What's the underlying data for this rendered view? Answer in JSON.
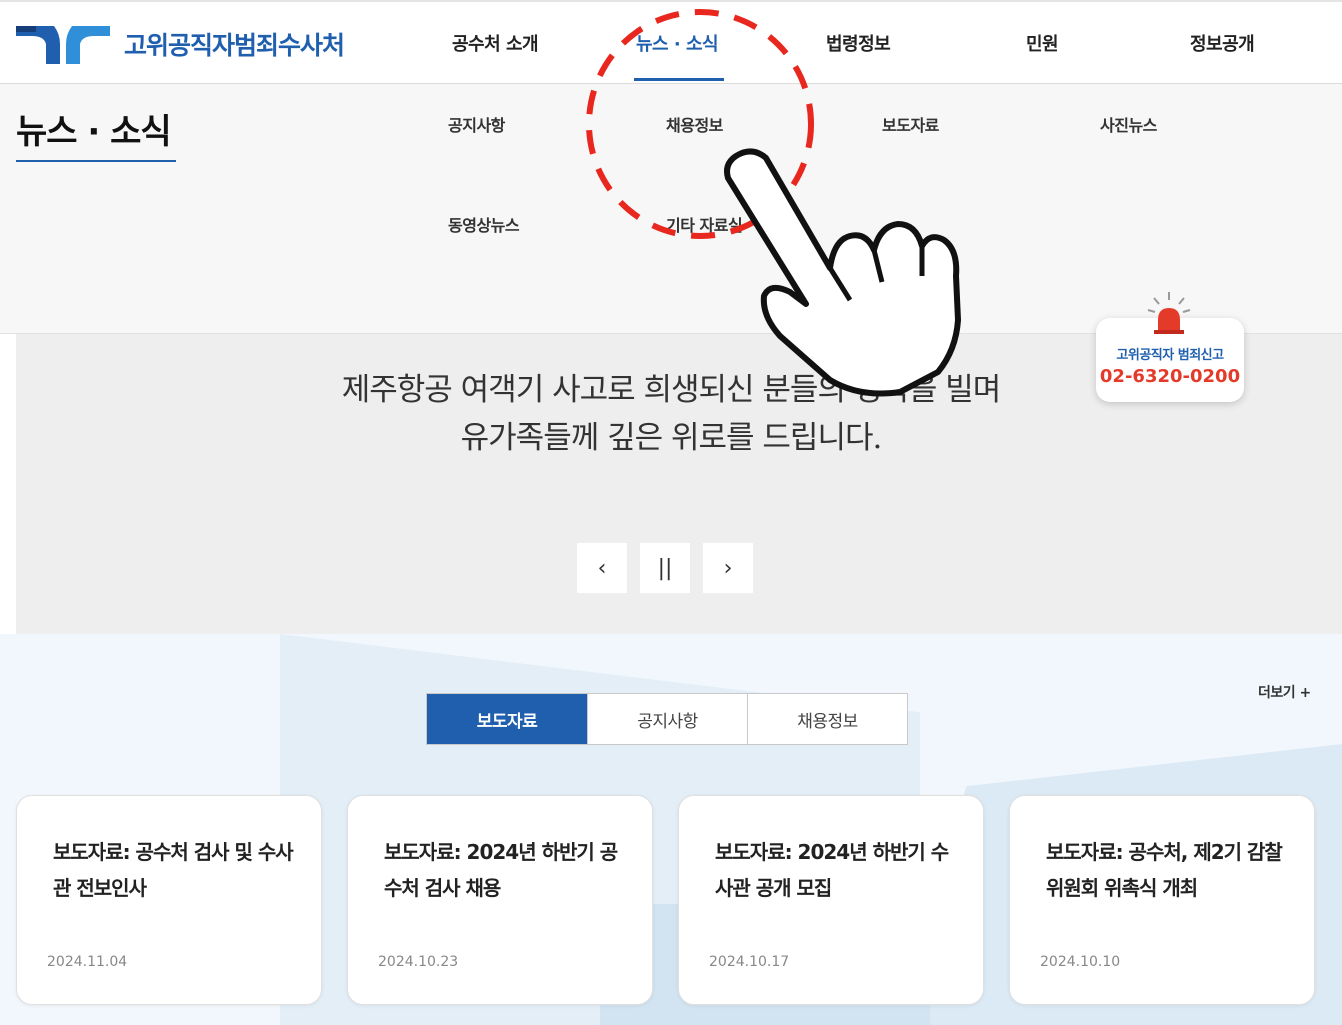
{
  "header": {
    "logo_text": "고위공직자범죄수사처",
    "nav": [
      {
        "label": "공수처 소개"
      },
      {
        "label": "뉴스 · 소식"
      },
      {
        "label": "법령정보"
      },
      {
        "label": "민원"
      },
      {
        "label": "정보공개"
      }
    ]
  },
  "submenu": {
    "title": "뉴스 · 소식",
    "items": [
      {
        "label": "공지사항"
      },
      {
        "label": "채용정보"
      },
      {
        "label": "보도자료"
      },
      {
        "label": "사진뉴스"
      },
      {
        "label": "동영상뉴스"
      },
      {
        "label": "기타 자료실"
      }
    ]
  },
  "banner": {
    "line1": "제주항공 여객기 사고로 희생되신 분들의 명복을 빌며",
    "line2": "유가족들께 깊은 위로를 드립니다.",
    "controls": {
      "prev": "‹",
      "pause": "||",
      "next": "›"
    }
  },
  "report": {
    "label": "고위공직자 범죄신고",
    "phone": "02-6320-0200"
  },
  "board": {
    "tabs": [
      {
        "label": "보도자료"
      },
      {
        "label": "공지사항"
      },
      {
        "label": "채용정보"
      }
    ],
    "more": "더보기 +",
    "cards": [
      {
        "title": "보도자료: 공수처 검사 및 수사관 전보인사",
        "date": "2024.11.04"
      },
      {
        "title": "보도자료: 2024년 하반기 공수처 검사 채용",
        "date": "2024.10.23"
      },
      {
        "title": "보도자료: 2024년 하반기 수사관 공개 모집",
        "date": "2024.10.17"
      },
      {
        "title": "보도자료: 공수처, 제2기 감찰위원회 위촉식 개최",
        "date": "2024.10.10"
      }
    ]
  },
  "colors": {
    "brand": "#1f5fae",
    "alert": "#e33a2a",
    "annotation": "#e8281e"
  },
  "icons": {
    "logo": "cio-logo-icon",
    "siren": "siren-icon",
    "pointer": "pointing-hand-icon"
  }
}
